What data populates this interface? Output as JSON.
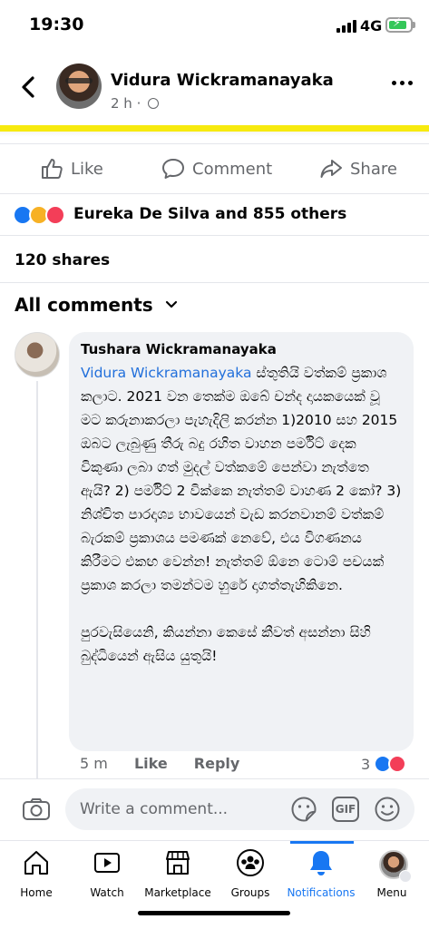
{
  "status_bar": {
    "time": "19:30",
    "network": "4G"
  },
  "post": {
    "author": "Vidura Wickramanayaka",
    "time": "2 h",
    "meta_sep": "·"
  },
  "actions": {
    "like": "Like",
    "comment": "Comment",
    "share": "Share"
  },
  "reactions": {
    "summary": "Eureka De Silva and 855 others",
    "icons": [
      "like-icon",
      "haha-icon",
      "love-icon"
    ]
  },
  "shares": "120 shares",
  "comments_header": "All comments",
  "comment": {
    "author": "Tushara Wickramanayaka",
    "mention": "Vidura Wickramanayaka",
    "body": "ස්තුතියි වත්කම් ප්‍රකාශ කලාට. 2021 වන තෙක්ම ඔබේ චන්ද දායකයෙක් වූ මට කරුනාකරලා පැහැදිලි කරන්න 1)2010 සහ 2015 ඔබට ලැබුණු තීරු බදු රහිත වාහන පර්මිට් දෙක විකුණා ලබා ගත් මුදල් වත්කමේ පෙන්වා නැත්තෙ ඇයි? 2) පර්මිට් 2 වික්කෙ නැත්තම් වාහණ 2 කෝ? 3) නිශ්චිත පාරදෘශ්‍ය භාවයෙන් වැඩ කරනවානම් වත්කම් බැරකම් ප්‍රකාශය පමණක් නෙවේ, එය විගණනය කිරීමට එකඟ වෙන්න! නැත්තම් ඕනෙ ටොම් පචයක් ප්‍රකාශ කරලා තමන්ටම හුරේ දාගත්තැහිකිනෙ.",
    "body2": "පුරවැසියෙනි, කියන්නා කෙසේ කීවත් අසන්නා සිහි බුද්ධියෙන් ඇසිය යුතුයි!",
    "time": "5 m",
    "like": "Like",
    "reply": "Reply",
    "reaction_count": "3"
  },
  "composer": {
    "placeholder": "Write a comment...",
    "gif": "GIF"
  },
  "nav": {
    "items": [
      {
        "label": "Home",
        "icon": "home-icon"
      },
      {
        "label": "Watch",
        "icon": "watch-icon"
      },
      {
        "label": "Marketplace",
        "icon": "marketplace-icon"
      },
      {
        "label": "Groups",
        "icon": "groups-icon"
      },
      {
        "label": "Notifications",
        "icon": "bell-icon"
      },
      {
        "label": "Menu",
        "icon": "menu-avatar"
      }
    ],
    "active": "Notifications"
  },
  "colors": {
    "accent": "#1877f2",
    "secondary_text": "#65676b",
    "bubble": "#f0f2f5",
    "banner": "#f7ea0f"
  }
}
